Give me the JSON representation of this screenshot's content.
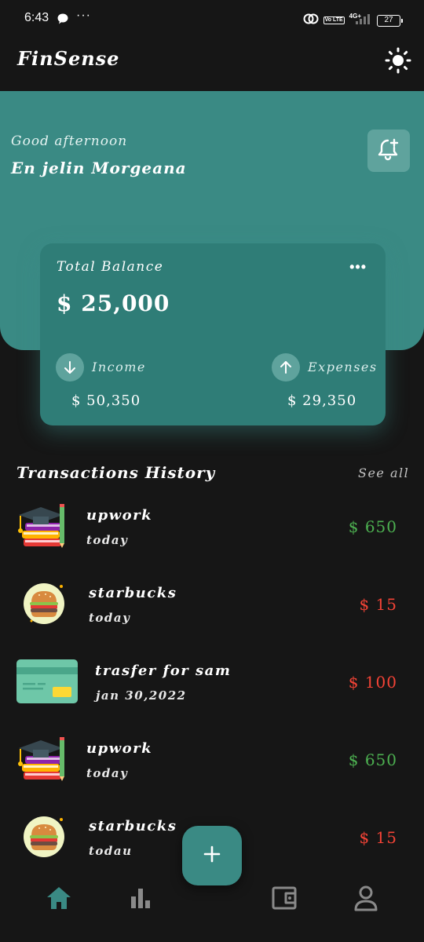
{
  "status_bar": {
    "time": "6:43",
    "network": "4G+",
    "volte": "Vo LTE",
    "battery": "27"
  },
  "app": {
    "title": "FinSense"
  },
  "header": {
    "greeting": "Good afternoon",
    "user_name": "En jelin Morgeana"
  },
  "balance_card": {
    "label": "Total Balance",
    "menu": "•••",
    "amount": "$ 25,000",
    "income": {
      "label": "Income",
      "amount": "$ 50,350"
    },
    "expenses": {
      "label": "Expenses",
      "amount": "$ 29,350"
    }
  },
  "transactions": {
    "title": "Transactions History",
    "see_all": "See all",
    "items": [
      {
        "icon": "books-graduation-icon",
        "name": "upwork",
        "date": "today",
        "amount": "$ 650",
        "type": "income"
      },
      {
        "icon": "burger-icon",
        "name": "starbucks",
        "date": "today",
        "amount": "$ 15",
        "type": "expense"
      },
      {
        "icon": "credit-card-icon",
        "name": "trasfer for sam",
        "date": "jan 30,2022",
        "amount": "$ 100",
        "type": "expense"
      },
      {
        "icon": "books-graduation-icon",
        "name": "upwork",
        "date": "today",
        "amount": "$ 650",
        "type": "income"
      },
      {
        "icon": "burger-icon",
        "name": "starbucks",
        "date": "todau",
        "amount": "$ 15",
        "type": "expense"
      }
    ]
  },
  "colors": {
    "accent": "#3a8a84",
    "card": "#2f7d77",
    "income": "#4caf50",
    "expense": "#f44336",
    "background": "#161616"
  },
  "nav": {
    "items": [
      "home-icon",
      "bar-chart-icon",
      "wallet-icon",
      "profile-icon"
    ],
    "fab": "plus-icon"
  }
}
